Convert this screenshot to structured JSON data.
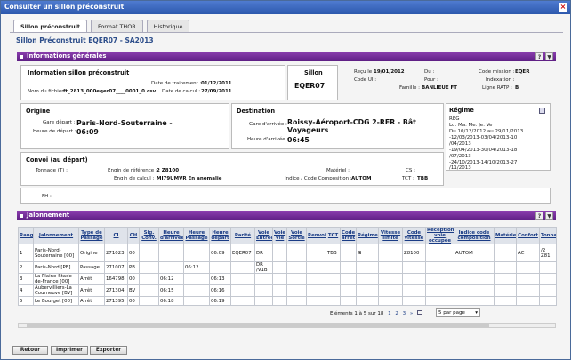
{
  "window": {
    "title": "Consulter un sillon préconstruit",
    "close": "×"
  },
  "tabs": [
    "Sillon préconstruit",
    "Format THOR",
    "Historique"
  ],
  "page_title": "Sillon Préconstruit EQER07 - SA2013",
  "info_section": {
    "title": "Informations générales",
    "help": "?",
    "collapse": "▼"
  },
  "info_sillon": {
    "title": "Information sillon préconstruit",
    "date_traitement_label": "Date de traitement :",
    "date_traitement": "01/12/2011",
    "nom_fichier_label": "Nom du fichier :",
    "nom_fichier": "ft_2813_000eqer07____0001_0.csv",
    "date_calcul_label": "Date de calcul :",
    "date_calcul": "27/09/2011"
  },
  "sillon": {
    "title": "Sillon",
    "value": "EQER07"
  },
  "meta": {
    "recu_label": "Reçu le :",
    "recu": "19/01/2012",
    "code_ui_label": "Code UI :",
    "code_ui": "",
    "du_label": "Du :",
    "du": "",
    "pour_label": "Pour :",
    "pour": "",
    "famille_label": "Famille :",
    "famille": "BANLIEUE FT",
    "code_mission_label": "Code mission :",
    "code_mission": "EQER",
    "indexation_label": "Indexation :",
    "indexation": "",
    "ligne_ratp_label": "Ligne RATP :",
    "ligne_ratp": "B"
  },
  "origine": {
    "title": "Origine",
    "gare_label": "Gare départ :",
    "gare": "Paris-Nord-Souterraine -",
    "heure_label": "Heure de départ :",
    "heure": "06:09"
  },
  "destination": {
    "title": "Destination",
    "gare_label": "Gare d'arrivée :",
    "gare1": "Roissy-Aéroport-CDG 2-RER - Bât",
    "gare2": "Voyageurs",
    "heure_label": "Heure d'arrivée :",
    "heure": "06:45"
  },
  "regime": {
    "title": "Régime",
    "lines": [
      "REG",
      "Lu. Ma. Me. Je. Ve",
      "Du 10/12/2012 au 29/11/2013",
      "-12/03/2013-03/04/2013-10",
      "/04/2013",
      "-19/04/2013-30/04/2013-18",
      "/07/2013",
      "-24/10/2013-14/10/2013-27",
      "/11/2013"
    ]
  },
  "convoi": {
    "title": "Convoi (au départ)",
    "tonnage_label": "Tonnage (T) :",
    "tonnage": "",
    "engin_ref_label": "Engin de référence :",
    "engin_ref": "2 Z8100",
    "engin_calc_label": "Engin de calcul :",
    "engin_calc": "MI79UMVR En anomalie",
    "materiel_label": "Matériel :",
    "materiel": "",
    "indice_label": "Indice / Code Composition :",
    "indice": "AUTOM",
    "cs_label": "CS :",
    "cs": "",
    "tct_label": "TCT :",
    "tct": "TBB"
  },
  "fh": {
    "label": "FH :",
    "value": ""
  },
  "jalonnement_section": {
    "title": "Jalonnement",
    "help": "?",
    "collapse": "▼"
  },
  "table": {
    "headers": [
      "Rang",
      "Jalonnement",
      "Type de Passage",
      "CI",
      "CH",
      "Sig. Conv.",
      "Heure d'arrivée",
      "Heure Passage",
      "Heure départ",
      "Parité",
      "Voie Entrée",
      "Voie Vie",
      "Voie Sortie",
      "Renvoi",
      "TCT",
      "Code arrêt",
      "Régime",
      "Vitesse limite",
      "Code vitesse",
      "Réception voie occupée",
      "Indice code composition",
      "Matériel",
      "Confort",
      "Tonnage"
    ],
    "rows": [
      [
        "1",
        "Paris-Nord-Souterraine [00]",
        "Origine",
        "271023",
        "00",
        "",
        "",
        "",
        "06:09",
        "EQER07",
        "DR",
        "",
        "",
        "",
        "TBB",
        "",
        "⊞",
        "",
        "Z8100",
        "",
        "AUTOM",
        "",
        "AC",
        "/2 Z81"
      ],
      [
        "2",
        "Paris-Nord [PB]",
        "Passage",
        "271007",
        "PB",
        "",
        "",
        "06:12",
        "",
        "",
        "DR /V1B",
        "",
        "",
        "",
        "",
        "",
        "",
        "",
        "",
        "",
        "",
        "",
        "",
        ""
      ],
      [
        "3",
        "La Plaine-Stade-de-France [00]",
        "Arrêt",
        "164798",
        "00",
        "",
        "06:12",
        "",
        "06:13",
        "",
        "",
        "",
        "",
        "",
        "",
        "",
        "",
        "",
        "",
        "",
        "",
        "",
        "",
        ""
      ],
      [
        "4",
        "Aubervilliers-La Courneuve [BV]",
        "Arrêt",
        "271304",
        "BV",
        "",
        "06:15",
        "",
        "06:16",
        "",
        "",
        "",
        "",
        "",
        "",
        "",
        "",
        "",
        "",
        "",
        "",
        "",
        "",
        ""
      ],
      [
        "5",
        "Le Bourget [00]",
        "Arrêt",
        "271395",
        "00",
        "",
        "06:18",
        "",
        "06:19",
        "",
        "",
        "",
        "",
        "",
        "",
        "",
        "",
        "",
        "",
        "",
        "",
        "",
        "",
        ""
      ]
    ]
  },
  "pager": {
    "text": "Eléments 1 à 5 sur 18",
    "pages": [
      "1",
      "2",
      "3"
    ],
    "next": "»",
    "per_page": "5 par page"
  },
  "buttons": {
    "retour": "Retour",
    "imprimer": "Imprimer",
    "exporter": "Exporter"
  }
}
